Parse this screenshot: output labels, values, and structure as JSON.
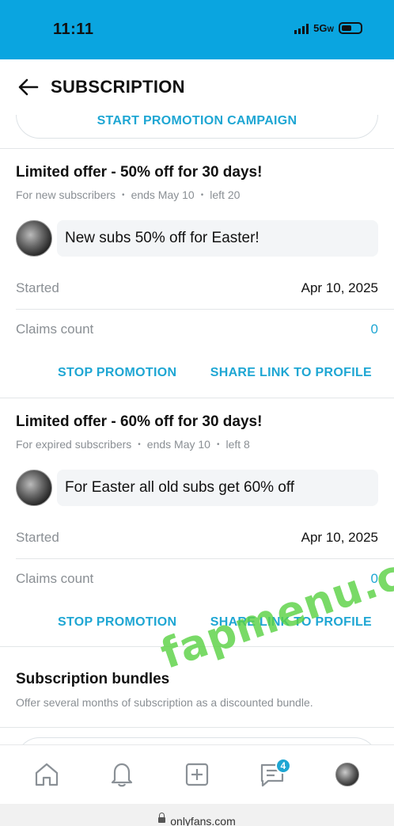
{
  "status_bar": {
    "time": "11:11",
    "network": "5G",
    "network_sub": "W"
  },
  "header": {
    "title": "SUBSCRIPTION"
  },
  "campaign_button": {
    "label": "START PROMOTION CAMPAIGN"
  },
  "promotions": [
    {
      "title": "Limited offer - 50% off for 30 days!",
      "audience": "For new subscribers",
      "ends": "ends May 10",
      "left": "left 20",
      "message": "New subs 50% off for Easter!",
      "started_label": "Started",
      "started_value": "Apr 10, 2025",
      "claims_label": "Claims count",
      "claims_value": "0",
      "stop_label": "STOP PROMOTION",
      "share_label": "SHARE LINK TO PROFILE"
    },
    {
      "title": "Limited offer - 60% off for 30 days!",
      "audience": "For expired subscribers",
      "ends": "ends May 10",
      "left": "left 8",
      "message": "For Easter all old subs get 60% off",
      "started_label": "Started",
      "started_value": "Apr 10, 2025",
      "claims_label": "Claims count",
      "claims_value": "0",
      "stop_label": "STOP PROMOTION",
      "share_label": "SHARE LINK TO PROFILE"
    }
  ],
  "bundles": {
    "title": "Subscription bundles",
    "description": "Offer several months of subscription as a discounted bundle."
  },
  "bottom_nav": {
    "items": [
      "home-icon",
      "notifications-icon",
      "add-post-icon",
      "messages-icon",
      "profile-avatar"
    ],
    "messages_badge": "4"
  },
  "url_bar": {
    "url": "onlyfans.com"
  },
  "watermark": {
    "text": "fapmenu.com"
  },
  "colors": {
    "status_bar": "#0aa5e0",
    "accent": "#1ea6d3",
    "watermark": "#5cd246"
  }
}
